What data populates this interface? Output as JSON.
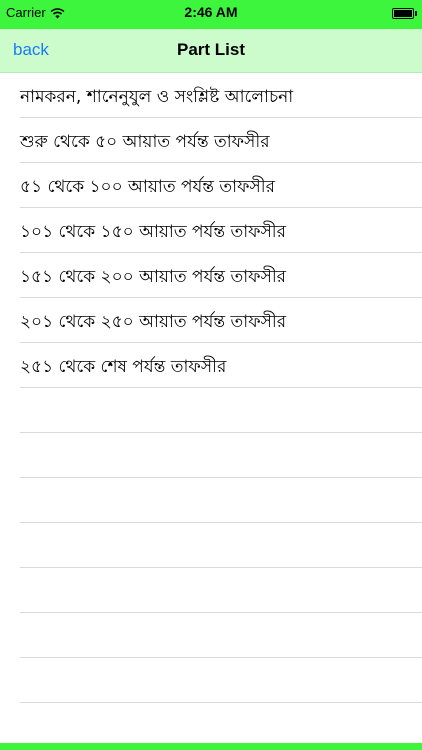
{
  "status_bar": {
    "carrier": "Carrier",
    "time": "2:46 AM",
    "wifi_icon": "wifi-icon",
    "battery_icon": "battery-icon",
    "color": "#3ef53e"
  },
  "nav": {
    "back_label": "back",
    "title": "Part List",
    "back_color": "#1a7cf5",
    "background": "#ccfccc"
  },
  "parts": [
    {
      "label": "নামকরন, শানেনুযুল ও সংশ্লিষ্ট  আলোচনা"
    },
    {
      "label": "শুরু থেকে ৫০ আয়াত পর্যন্ত  তাফসীর"
    },
    {
      "label": "৫১ থেকে ১০০ আয়াত পর্যন্ত  তাফসীর"
    },
    {
      "label": "১০১ থেকে ১৫০ আয়াত পর্যন্ত  তাফসীর"
    },
    {
      "label": "১৫১ থেকে ২০০ আয়াত পর্যন্ত  তাফসীর"
    },
    {
      "label": "২০১ থেকে ২৫০ আয়াত পর্যন্ত  তাফসীর"
    },
    {
      "label": "২৫১ থেকে শেষ পর্যন্ত  তাফসীর"
    }
  ]
}
